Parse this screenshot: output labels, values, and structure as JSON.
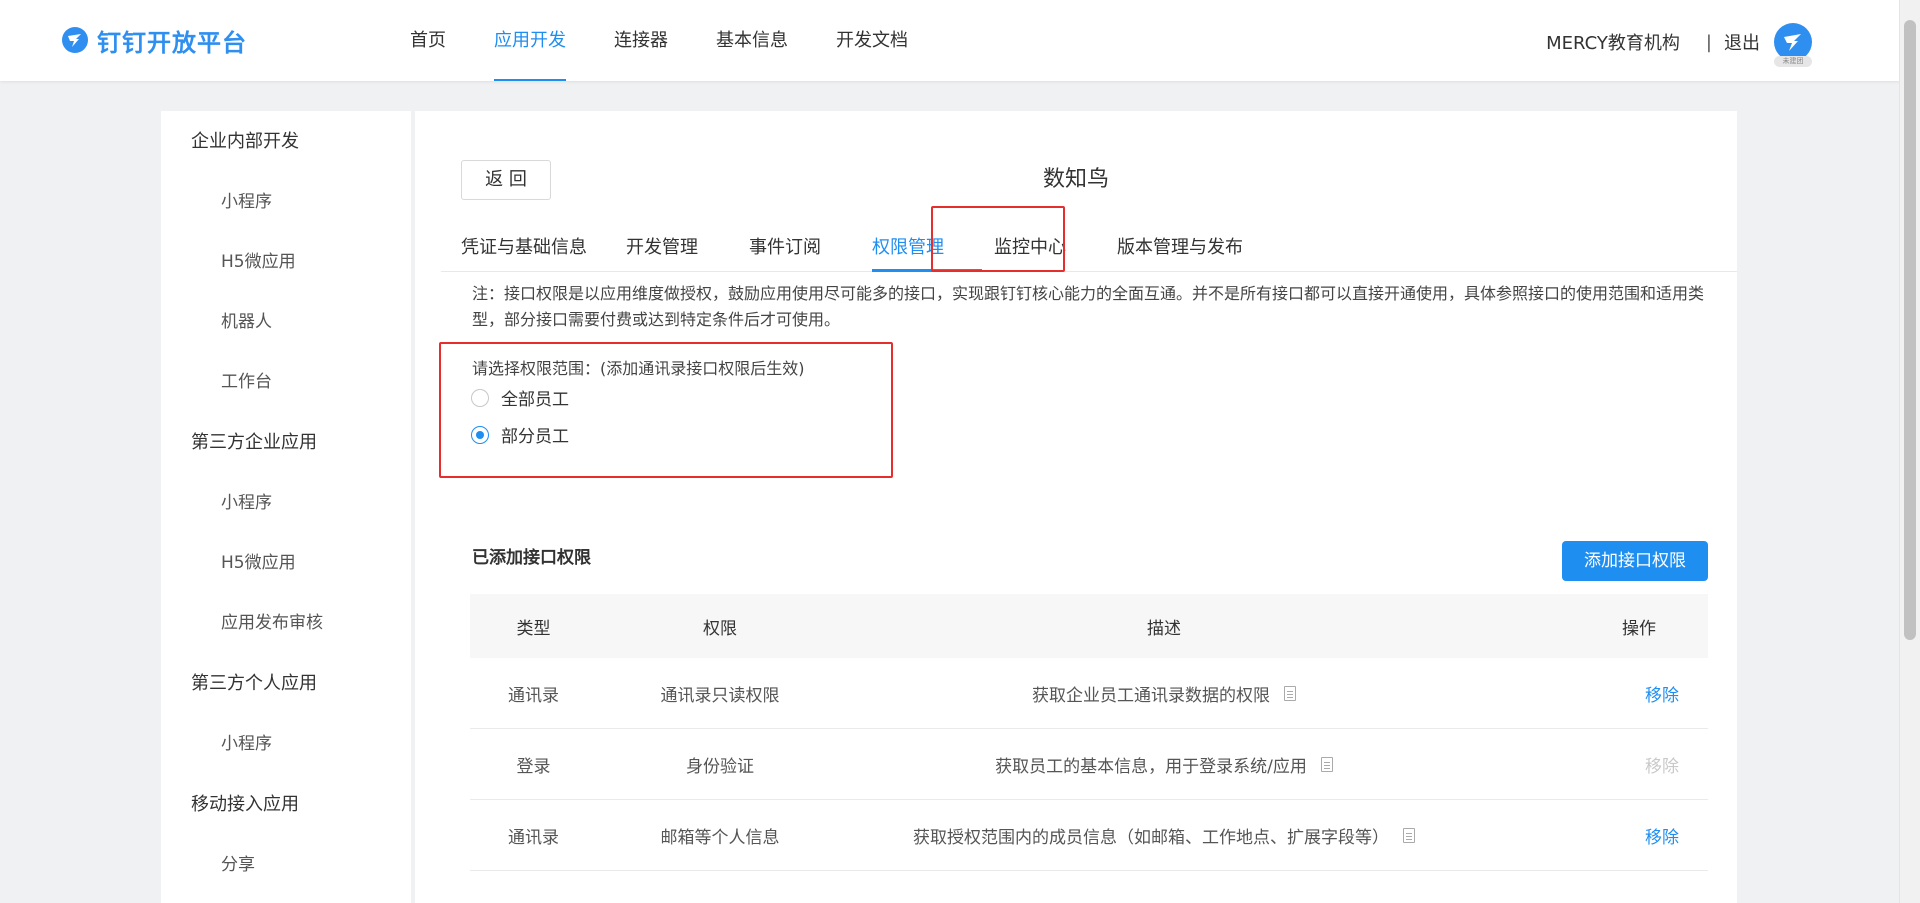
{
  "header": {
    "logo_text": "钉钉开放平台",
    "nav": [
      {
        "label": "首页",
        "active": false
      },
      {
        "label": "应用开发",
        "active": true
      },
      {
        "label": "连接器",
        "active": false
      },
      {
        "label": "基本信息",
        "active": false
      },
      {
        "label": "开发文档",
        "active": false
      }
    ],
    "org_name": "MERCY教育机构",
    "separator": "|",
    "logout": "退出",
    "avatar_badge": "未建团",
    "accent": "#1f8ef1"
  },
  "sidebar": {
    "groups": [
      {
        "label": "企业内部开发",
        "items": [
          "小程序",
          "H5微应用",
          "机器人",
          "工作台"
        ]
      },
      {
        "label": "第三方企业应用",
        "items": [
          "小程序",
          "H5微应用",
          "应用发布审核"
        ]
      },
      {
        "label": "第三方个人应用",
        "items": [
          "小程序"
        ]
      },
      {
        "label": "移动接入应用",
        "items": [
          "分享"
        ]
      }
    ]
  },
  "main": {
    "back_label": "返 回",
    "app_title": "数知鸟",
    "tabs": [
      {
        "label": "凭证与基础信息",
        "active": false
      },
      {
        "label": "开发管理",
        "active": false
      },
      {
        "label": "事件订阅",
        "active": false
      },
      {
        "label": "权限管理",
        "active": true
      },
      {
        "label": "监控中心",
        "active": false
      },
      {
        "label": "版本管理与发布",
        "active": false
      }
    ],
    "note": "注：接口权限是以应用维度做授权，鼓励应用使用尽可能多的接口，实现跟钉钉核心能力的全面互通。并不是所有接口都可以直接开通使用，具体参照接口的使用范围和适用类型，部分接口需要付费或达到特定条件后才可使用。",
    "scope": {
      "label": "请选择权限范围：(添加通讯录接口权限后生效)",
      "options": [
        {
          "label": "全部员工",
          "checked": false
        },
        {
          "label": "部分员工",
          "checked": true
        }
      ]
    },
    "added_title": "已添加接口权限",
    "add_button": "添加接口权限",
    "table": {
      "headers": {
        "type": "类型",
        "perm": "权限",
        "desc": "描述",
        "op": "操作"
      },
      "rows": [
        {
          "type": "通讯录",
          "perm": "通讯录只读权限",
          "desc": "获取企业员工通讯录数据的权限",
          "op": "移除",
          "op_disabled": false
        },
        {
          "type": "登录",
          "perm": "身份验证",
          "desc": "获取员工的基本信息，用于登录系统/应用",
          "op": "移除",
          "op_disabled": true
        },
        {
          "type": "通讯录",
          "perm": "邮箱等个人信息",
          "desc": "获取授权范围内的成员信息（如邮箱、工作地点、扩展字段等）",
          "op": "移除",
          "op_disabled": false
        }
      ]
    }
  }
}
